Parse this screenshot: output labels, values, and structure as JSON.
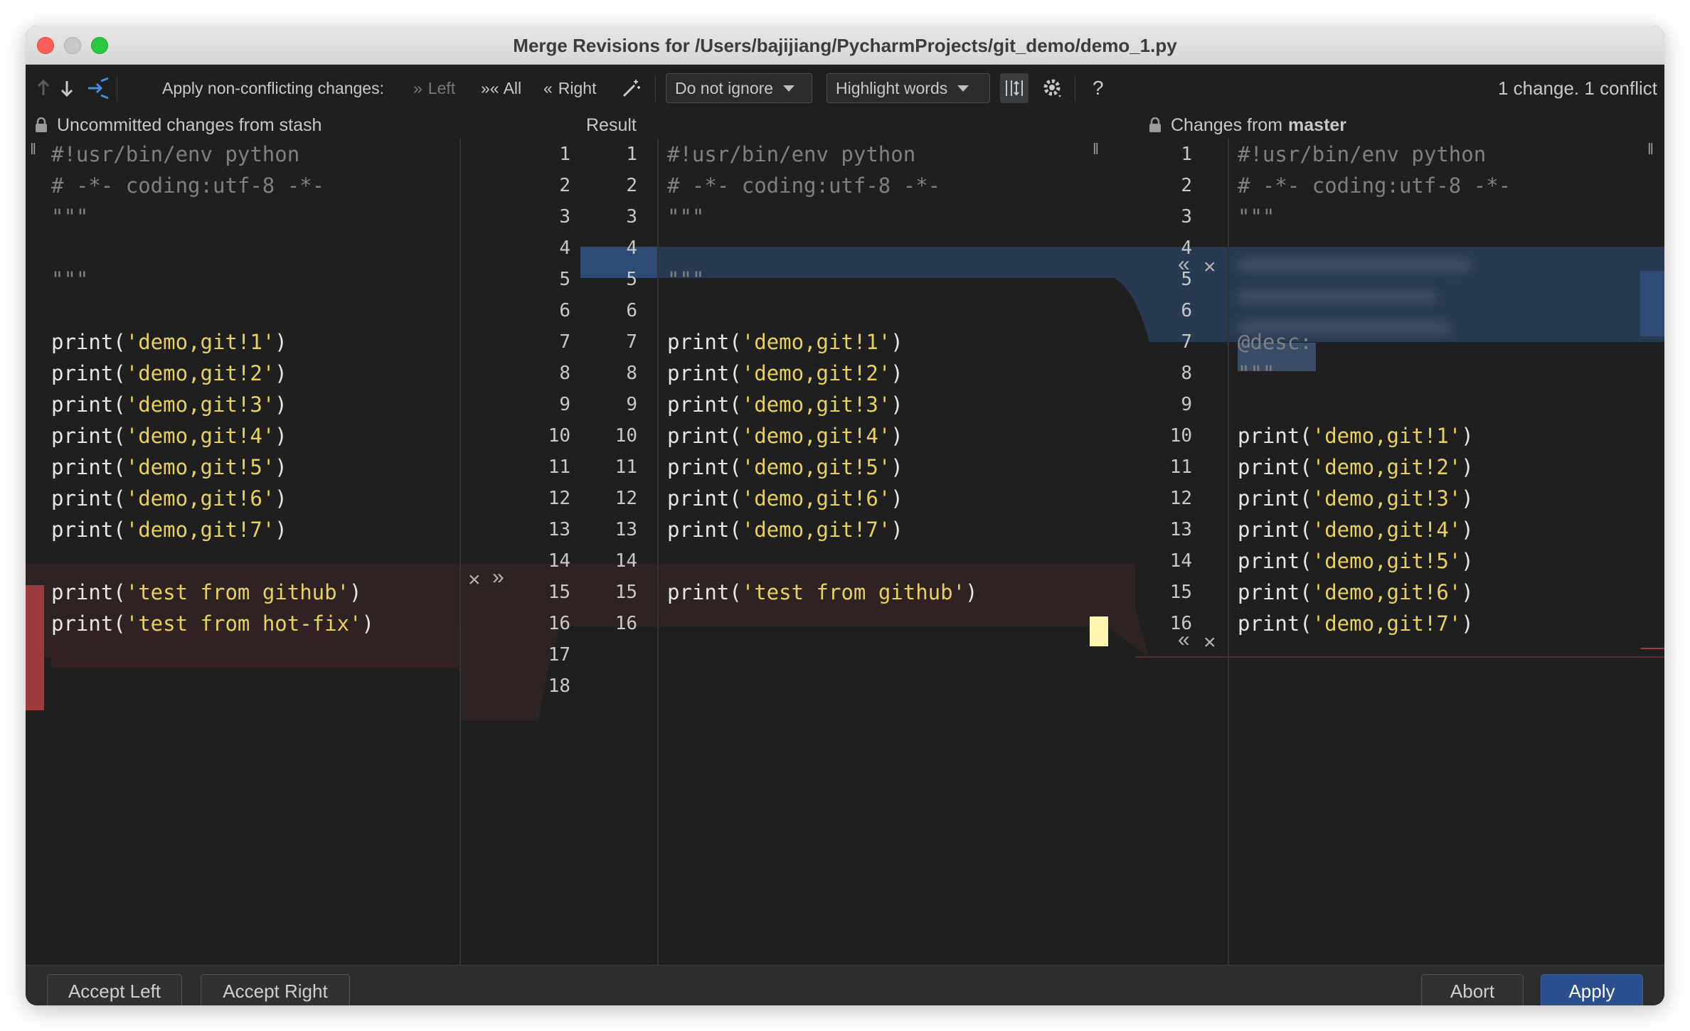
{
  "window": {
    "title": "Merge Revisions for /Users/bajijiang/PycharmProjects/git_demo/demo_1.py"
  },
  "toolbar": {
    "apply_label": "Apply non-conflicting changes:",
    "left_label": "Left",
    "all_label": "All",
    "right_label": "Right",
    "ignore_select": "Do not ignore",
    "highlight_select": "Highlight words",
    "help_label": "?",
    "status": "1 change. 1 conflict"
  },
  "panes": {
    "left_header": "Uncommitted changes from stash",
    "center_header": "Result",
    "right_header_prefix": "Changes from",
    "right_header_branch": "master"
  },
  "left_lines": [
    "#!usr/bin/env python",
    "# -*- coding:utf-8 -*-",
    "\"\"\"",
    "",
    "\"\"\"",
    "",
    "print('demo,git!1')",
    "print('demo,git!2')",
    "print('demo,git!3')",
    "print('demo,git!4')",
    "print('demo,git!5')",
    "print('demo,git!6')",
    "print('demo,git!7')",
    "",
    "print('test from github')",
    "print('test from hot-fix')",
    "",
    ""
  ],
  "left_numbers": [
    "1",
    "2",
    "3",
    "4",
    "5",
    "6",
    "7",
    "8",
    "9",
    "10",
    "11",
    "12",
    "13",
    "14",
    "15",
    "16",
    "17",
    "18"
  ],
  "result_numbers": [
    "1",
    "2",
    "3",
    "4",
    "5",
    "6",
    "7",
    "8",
    "9",
    "10",
    "11",
    "12",
    "13",
    "14",
    "15",
    "16"
  ],
  "result_lines": [
    "#!usr/bin/env python",
    "# -*- coding:utf-8 -*-",
    "\"\"\"",
    "",
    "\"\"\"",
    "",
    "print('demo,git!1')",
    "print('demo,git!2')",
    "print('demo,git!3')",
    "print('demo,git!4')",
    "print('demo,git!5')",
    "print('demo,git!6')",
    "print('demo,git!7')",
    "",
    "print('test from github')",
    ""
  ],
  "right_numbers": [
    "1",
    "2",
    "3",
    "4",
    "5",
    "6",
    "7",
    "8",
    "9",
    "10",
    "11",
    "12",
    "13",
    "14",
    "15",
    "16"
  ],
  "right_lines": [
    "#!usr/bin/env python",
    "# -*- coding:utf-8 -*-",
    "\"\"\"",
    "",
    "",
    "",
    "@desc:",
    "\"\"\"",
    "",
    "print('demo,git!1')",
    "print('demo,git!2')",
    "print('demo,git!3')",
    "print('demo,git!4')",
    "print('demo,git!5')",
    "print('demo,git!6')",
    "print('demo,git!7')"
  ],
  "buttons": {
    "accept_left": "Accept Left",
    "accept_right": "Accept Right",
    "abort": "Abort",
    "apply": "Apply"
  }
}
